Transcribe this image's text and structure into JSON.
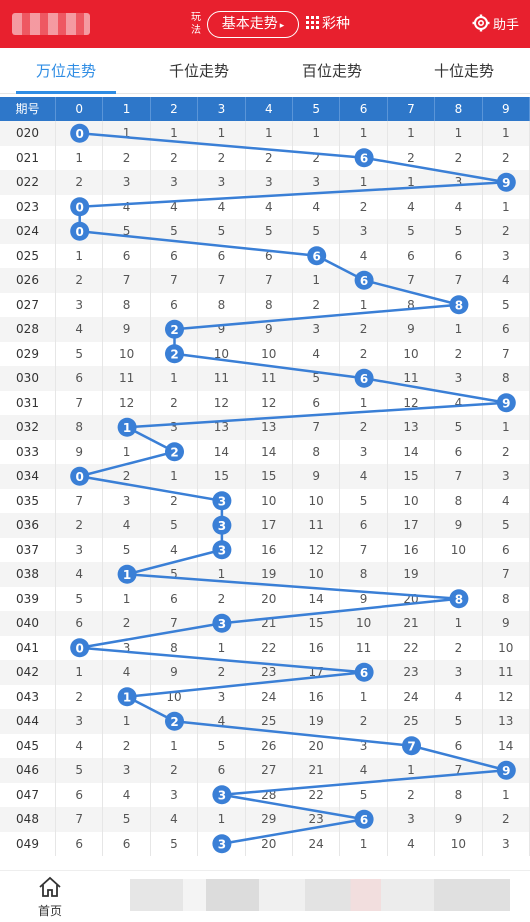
{
  "header": {
    "wanfa_label": "玩法",
    "mode_label": "基本走势",
    "colors_label": "彩种",
    "settings_label": "助手"
  },
  "tabs": [
    {
      "label": "万位走势",
      "active": true
    },
    {
      "label": "千位走势",
      "active": false
    },
    {
      "label": "百位走势",
      "active": false
    },
    {
      "label": "十位走势",
      "active": false
    }
  ],
  "table": {
    "header_issue": "期号",
    "digit_headers": [
      "0",
      "1",
      "2",
      "3",
      "4",
      "5",
      "6",
      "7",
      "8",
      "9"
    ],
    "rows": [
      {
        "issue": "020",
        "cells": [
          "0",
          "1",
          "1",
          "1",
          "1",
          "1",
          "1",
          "1",
          "1",
          "1"
        ],
        "hit": 0
      },
      {
        "issue": "021",
        "cells": [
          "1",
          "2",
          "2",
          "2",
          "2",
          "2",
          "6",
          "2",
          "2",
          "2"
        ],
        "hit": 6
      },
      {
        "issue": "022",
        "cells": [
          "2",
          "3",
          "3",
          "3",
          "3",
          "3",
          "1",
          "1",
          "3",
          "9"
        ],
        "hit": 9
      },
      {
        "issue": "023",
        "cells": [
          "0",
          "4",
          "4",
          "4",
          "4",
          "4",
          "2",
          "4",
          "4",
          "1"
        ],
        "hit": 0
      },
      {
        "issue": "024",
        "cells": [
          "0",
          "5",
          "5",
          "5",
          "5",
          "5",
          "3",
          "5",
          "5",
          "2"
        ],
        "hit": 0
      },
      {
        "issue": "025",
        "cells": [
          "1",
          "6",
          "6",
          "6",
          "6",
          "6",
          "4",
          "6",
          "6",
          "3"
        ],
        "hit": 5
      },
      {
        "issue": "026",
        "cells": [
          "2",
          "7",
          "7",
          "7",
          "7",
          "1",
          "6",
          "7",
          "7",
          "4"
        ],
        "hit": 6
      },
      {
        "issue": "027",
        "cells": [
          "3",
          "8",
          "6",
          "8",
          "8",
          "2",
          "1",
          "8",
          "8",
          "5"
        ],
        "hit": 8
      },
      {
        "issue": "028",
        "cells": [
          "4",
          "9",
          "2",
          "9",
          "9",
          "3",
          "2",
          "9",
          "1",
          "6"
        ],
        "hit": 2
      },
      {
        "issue": "029",
        "cells": [
          "5",
          "10",
          "2",
          "10",
          "10",
          "4",
          "2",
          "10",
          "2",
          "7"
        ],
        "hit": 2
      },
      {
        "issue": "030",
        "cells": [
          "6",
          "11",
          "1",
          "11",
          "11",
          "5",
          "6",
          "11",
          "3",
          "8"
        ],
        "hit": 6
      },
      {
        "issue": "031",
        "cells": [
          "7",
          "12",
          "2",
          "12",
          "12",
          "6",
          "1",
          "12",
          "4",
          "9"
        ],
        "hit": 9
      },
      {
        "issue": "032",
        "cells": [
          "8",
          "1",
          "3",
          "13",
          "13",
          "7",
          "2",
          "13",
          "5",
          "1"
        ],
        "hit": 1
      },
      {
        "issue": "033",
        "cells": [
          "9",
          "1",
          "2",
          "14",
          "14",
          "8",
          "3",
          "14",
          "6",
          "2"
        ],
        "hit": 2
      },
      {
        "issue": "034",
        "cells": [
          "0",
          "2",
          "1",
          "15",
          "15",
          "9",
          "4",
          "15",
          "7",
          "3"
        ],
        "hit": 0
      },
      {
        "issue": "035",
        "cells": [
          "7",
          "3",
          "2",
          "3",
          "10",
          "10",
          "5",
          "10",
          "8",
          "4"
        ],
        "hit": 3
      },
      {
        "issue": "036",
        "cells": [
          "2",
          "4",
          "5",
          "3",
          "17",
          "11",
          "6",
          "17",
          "9",
          "5"
        ],
        "hit": 3
      },
      {
        "issue": "037",
        "cells": [
          "3",
          "5",
          "4",
          "3",
          "16",
          "12",
          "7",
          "16",
          "10",
          "6"
        ],
        "hit": 3
      },
      {
        "issue": "038",
        "cells": [
          "4",
          "1",
          "5",
          "1",
          "19",
          "10",
          "8",
          "19",
          "",
          "7"
        ],
        "hit": 1
      },
      {
        "issue": "039",
        "cells": [
          "5",
          "1",
          "6",
          "2",
          "20",
          "14",
          "9",
          "20",
          "8",
          "8"
        ],
        "hit": 8
      },
      {
        "issue": "040",
        "cells": [
          "6",
          "2",
          "7",
          "3",
          "21",
          "15",
          "10",
          "21",
          "1",
          "9"
        ],
        "hit": 3
      },
      {
        "issue": "041",
        "cells": [
          "0",
          "3",
          "8",
          "1",
          "22",
          "16",
          "11",
          "22",
          "2",
          "10"
        ],
        "hit": 0
      },
      {
        "issue": "042",
        "cells": [
          "1",
          "4",
          "9",
          "2",
          "23",
          "17",
          "6",
          "23",
          "3",
          "11"
        ],
        "hit": 6
      },
      {
        "issue": "043",
        "cells": [
          "2",
          "1",
          "10",
          "3",
          "24",
          "16",
          "1",
          "24",
          "4",
          "12"
        ],
        "hit": 1
      },
      {
        "issue": "044",
        "cells": [
          "3",
          "1",
          "2",
          "4",
          "25",
          "19",
          "2",
          "25",
          "5",
          "13"
        ],
        "hit": 2
      },
      {
        "issue": "045",
        "cells": [
          "4",
          "2",
          "1",
          "5",
          "26",
          "20",
          "3",
          "7",
          "6",
          "14"
        ],
        "hit": 7
      },
      {
        "issue": "046",
        "cells": [
          "5",
          "3",
          "2",
          "6",
          "27",
          "21",
          "4",
          "1",
          "7",
          "9"
        ],
        "hit": 9
      },
      {
        "issue": "047",
        "cells": [
          "6",
          "4",
          "3",
          "3",
          "28",
          "22",
          "5",
          "2",
          "8",
          "1"
        ],
        "hit": 3
      },
      {
        "issue": "048",
        "cells": [
          "7",
          "5",
          "4",
          "1",
          "29",
          "23",
          "6",
          "3",
          "9",
          "2"
        ],
        "hit": 6
      },
      {
        "issue": "049",
        "cells": [
          "6",
          "6",
          "5",
          "3",
          "20",
          "24",
          "1",
          "4",
          "10",
          "3"
        ],
        "hit": 3
      }
    ]
  },
  "colors": {
    "header_red": "#e8202e",
    "accent_blue": "#2f8de4",
    "table_header_blue": "#2e77c9",
    "ball_blue": "#3a7fd6"
  },
  "footer": {
    "home_label": "首页"
  }
}
